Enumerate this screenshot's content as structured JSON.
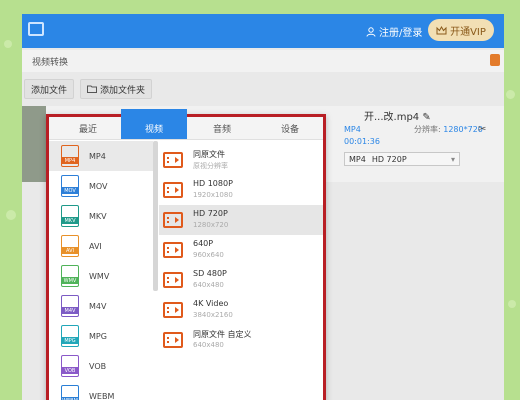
{
  "titlebar": {
    "login_text": "注册/登录",
    "vip_label": "开通VIP"
  },
  "breadcrumb": {
    "label": "视频转换"
  },
  "toolbar": {
    "add_file": "添加文件",
    "add_folder": "添加文件夹"
  },
  "file": {
    "name": "开...改.mp4",
    "format": "MP4",
    "duration": "00:01:36",
    "resolution_label": "分辨率:",
    "resolution_value": "1280*720",
    "output_format": "MP4",
    "output_preset": "HD 720P"
  },
  "popup": {
    "tabs": [
      {
        "label": "最近",
        "active": false
      },
      {
        "label": "视频",
        "active": true
      },
      {
        "label": "音频",
        "active": false
      },
      {
        "label": "设备",
        "active": false
      }
    ],
    "formats": [
      {
        "label": "MP4",
        "tag": "MP4",
        "color": "#e0641f",
        "selected": true
      },
      {
        "label": "MOV",
        "tag": "MOV",
        "color": "#2d7fd8",
        "selected": false
      },
      {
        "label": "MKV",
        "tag": "MKV",
        "color": "#1f9a8a",
        "selected": false
      },
      {
        "label": "AVI",
        "tag": "AVI",
        "color": "#e8912a",
        "selected": false
      },
      {
        "label": "WMV",
        "tag": "WMV",
        "color": "#4fb35a",
        "selected": false
      },
      {
        "label": "M4V",
        "tag": "M4V",
        "color": "#7c5bc4",
        "selected": false
      },
      {
        "label": "MPG",
        "tag": "MPG",
        "color": "#22a7b9",
        "selected": false
      },
      {
        "label": "VOB",
        "tag": "VOB",
        "color": "#8a59c9",
        "selected": false
      },
      {
        "label": "WEBM",
        "tag": "WEBM",
        "color": "#2a7fd6",
        "selected": false
      }
    ],
    "presets": [
      {
        "name": "同原文件",
        "desc": "原视分辨率",
        "selected": false
      },
      {
        "name": "HD 1080P",
        "desc": "1920x1080",
        "selected": false
      },
      {
        "name": "HD 720P",
        "desc": "1280x720",
        "selected": true
      },
      {
        "name": "640P",
        "desc": "960x640",
        "selected": false
      },
      {
        "name": "SD 480P",
        "desc": "640x480",
        "selected": false
      },
      {
        "name": "4K Video",
        "desc": "3840x2160",
        "selected": false
      },
      {
        "name": "同原文件 自定义",
        "desc": "640x480",
        "selected": false
      }
    ]
  },
  "colors": {
    "accent": "#2b86e6",
    "highlight_border": "#b81e24",
    "preset_icon": "#e05a1c"
  }
}
